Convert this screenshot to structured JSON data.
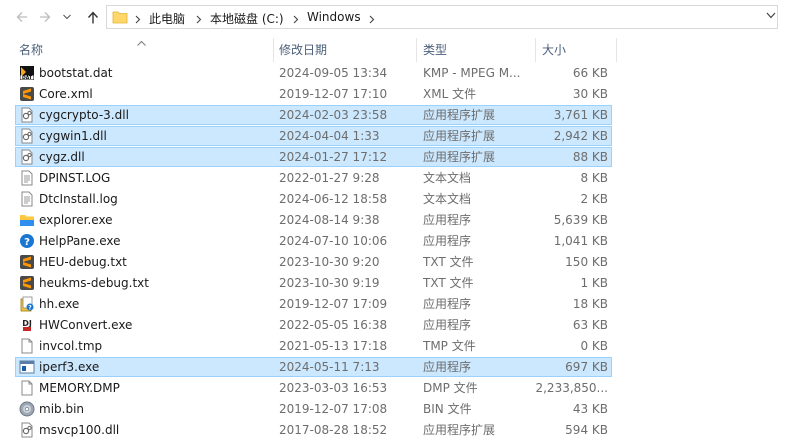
{
  "address": {
    "crumbs": [
      "此电脑",
      "本地磁盘 (C:)",
      "Windows"
    ]
  },
  "columns": {
    "name": "名称",
    "date": "修改日期",
    "type": "类型",
    "size": "大小"
  },
  "colors": {
    "selection": "#cce8ff",
    "selection_border": "#99d1ff",
    "header_text": "#4c607a"
  },
  "files": [
    {
      "name": "bootstat.dat",
      "date": "2024-09-05 13:34",
      "type": "KMP - MPEG M...",
      "size": "66 KB",
      "icon": "dat-icon",
      "selected": false
    },
    {
      "name": "Core.xml",
      "date": "2019-12-07 17:10",
      "type": "XML 文件",
      "size": "30 KB",
      "icon": "sublime-icon",
      "selected": false
    },
    {
      "name": "cygcrypto-3.dll",
      "date": "2024-02-03 23:58",
      "type": "应用程序扩展",
      "size": "3,761 KB",
      "icon": "dll-icon",
      "selected": true
    },
    {
      "name": "cygwin1.dll",
      "date": "2024-04-04 1:33",
      "type": "应用程序扩展",
      "size": "2,942 KB",
      "icon": "dll-icon",
      "selected": true
    },
    {
      "name": "cygz.dll",
      "date": "2024-01-27 17:12",
      "type": "应用程序扩展",
      "size": "88 KB",
      "icon": "dll-icon",
      "selected": true
    },
    {
      "name": "DPINST.LOG",
      "date": "2022-01-27 9:28",
      "type": "文本文档",
      "size": "8 KB",
      "icon": "text-file-icon",
      "selected": false
    },
    {
      "name": "DtcInstall.log",
      "date": "2024-06-12 18:58",
      "type": "文本文档",
      "size": "2 KB",
      "icon": "text-file-icon",
      "selected": false
    },
    {
      "name": "explorer.exe",
      "date": "2024-08-14 9:38",
      "type": "应用程序",
      "size": "5,639 KB",
      "icon": "explorer-icon",
      "selected": false
    },
    {
      "name": "HelpPane.exe",
      "date": "2024-07-10 10:06",
      "type": "应用程序",
      "size": "1,041 KB",
      "icon": "help-icon",
      "selected": false
    },
    {
      "name": "HEU-debug.txt",
      "date": "2023-10-30 9:20",
      "type": "TXT 文件",
      "size": "150 KB",
      "icon": "sublime-icon",
      "selected": false
    },
    {
      "name": "heukms-debug.txt",
      "date": "2023-10-30 9:19",
      "type": "TXT 文件",
      "size": "1 KB",
      "icon": "sublime-icon",
      "selected": false
    },
    {
      "name": "hh.exe",
      "date": "2019-12-07 17:09",
      "type": "应用程序",
      "size": "18 KB",
      "icon": "hh-icon",
      "selected": false
    },
    {
      "name": "HWConvert.exe",
      "date": "2022-05-05 16:38",
      "type": "应用程序",
      "size": "63 KB",
      "icon": "dj-icon",
      "selected": false
    },
    {
      "name": "invcol.tmp",
      "date": "2021-05-13 17:18",
      "type": "TMP 文件",
      "size": "0 KB",
      "icon": "blank-file-icon",
      "selected": false
    },
    {
      "name": "iperf3.exe",
      "date": "2024-05-11 7:13",
      "type": "应用程序",
      "size": "697 KB",
      "icon": "exe-icon",
      "selected": true
    },
    {
      "name": "MEMORY.DMP",
      "date": "2023-03-03 16:53",
      "type": "DMP 文件",
      "size": "2,233,850...",
      "icon": "blank-file-icon",
      "selected": false
    },
    {
      "name": "mib.bin",
      "date": "2019-12-07 17:08",
      "type": "BIN 文件",
      "size": "43 KB",
      "icon": "disc-icon",
      "selected": false
    },
    {
      "name": "msvcp100.dll",
      "date": "2017-08-28 18:52",
      "type": "应用程序扩展",
      "size": "594 KB",
      "icon": "dll-icon",
      "selected": false
    }
  ]
}
